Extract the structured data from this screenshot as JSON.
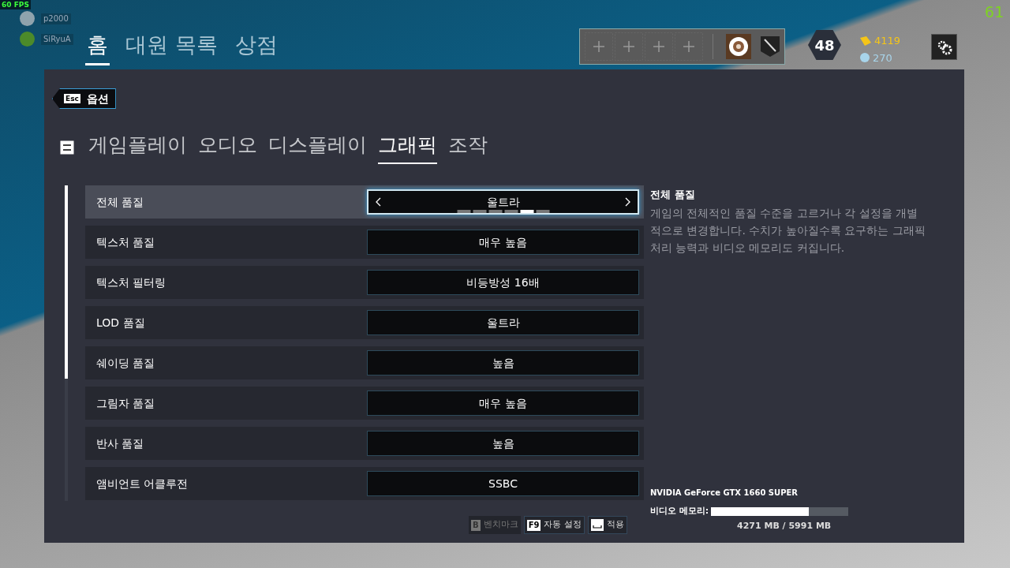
{
  "overlay": {
    "fps": "60 FPS",
    "counter": "61"
  },
  "friends": [
    {
      "name": "p2000"
    },
    {
      "name": "SiRyuA"
    }
  ],
  "nav_tabs": [
    {
      "label": "홈",
      "selected": true
    },
    {
      "label": "대원 목록",
      "selected": false
    },
    {
      "label": "상점",
      "selected": false
    }
  ],
  "player": {
    "level": "48",
    "renown": "4119",
    "credits": "270"
  },
  "back_button": {
    "key": "Esc",
    "label": "옵션"
  },
  "settings_tabs": [
    {
      "label": "게임플레이",
      "selected": false
    },
    {
      "label": "오디오",
      "selected": false
    },
    {
      "label": "디스플레이",
      "selected": false
    },
    {
      "label": "그래픽",
      "selected": true
    },
    {
      "label": "조작",
      "selected": false
    }
  ],
  "settings": [
    {
      "label": "전체 품질",
      "value": "울트라",
      "selected": true,
      "pips": [
        {
          "selected": false
        },
        {
          "selected": false
        },
        {
          "selected": false
        },
        {
          "selected": false
        },
        {
          "selected": true
        },
        {
          "selected": false
        }
      ]
    },
    {
      "label": "텍스처 품질",
      "value": "매우 높음",
      "selected": false
    },
    {
      "label": "텍스처 필터링",
      "value": "비등방성 16배",
      "selected": false
    },
    {
      "label": "LOD 품질",
      "value": "울트라",
      "selected": false
    },
    {
      "label": "쉐이딩 품질",
      "value": "높음",
      "selected": false
    },
    {
      "label": "그림자 품질",
      "value": "매우 높음",
      "selected": false
    },
    {
      "label": "반사 품질",
      "value": "높음",
      "selected": false
    },
    {
      "label": "앰비언트 어클루전",
      "value": "SSBC",
      "selected": false
    }
  ],
  "description": {
    "title": "전체 품질",
    "text": "게임의 전체적인 품질 수준을 고르거나 각 설정을 개별적으로 변경합니다. 수치가 높아질수록 요구하는 그래픽 처리 능력과 비디오 메모리도 커집니다."
  },
  "footer_buttons": [
    {
      "kind": "key",
      "key": "B",
      "label": "벤치마크",
      "disabled": true
    },
    {
      "kind": "key",
      "key": "F9",
      "label": "자동 설정",
      "disabled": false
    },
    {
      "kind": "space",
      "label": "적용",
      "disabled": false
    }
  ],
  "gpu": {
    "name": "NVIDIA GeForce GTX 1660 SUPER",
    "memory_label": "비디오 메모리:",
    "level": 0.713,
    "reading": "4271 MB / 5991 MB"
  }
}
